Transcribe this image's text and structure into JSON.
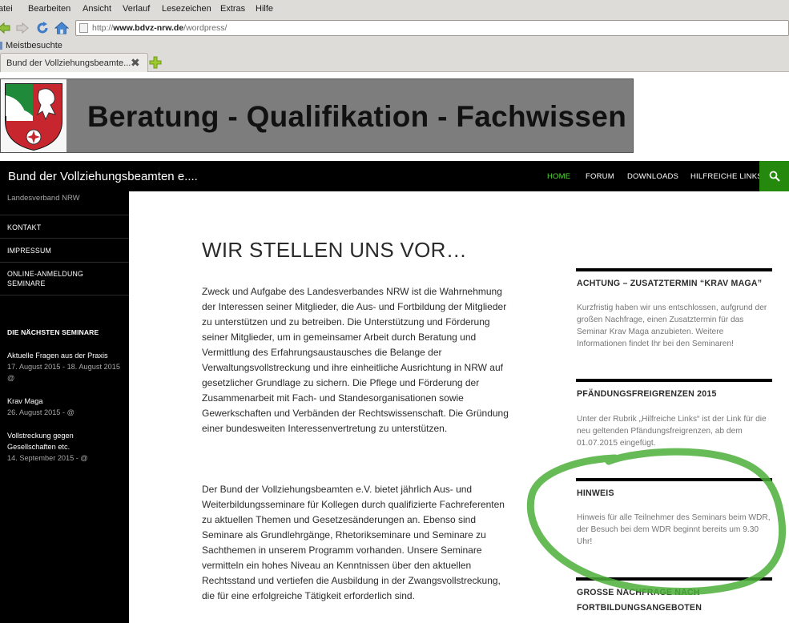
{
  "browser": {
    "menu": [
      {
        "key": "datei",
        "text": "atei",
        "underline": ""
      },
      {
        "key": "bearbeiten",
        "text": "Bearbeiten"
      },
      {
        "key": "ansicht",
        "text": "Ansicht"
      },
      {
        "key": "verlauf",
        "text": "Verlauf"
      },
      {
        "key": "lesezeichen",
        "text": "Lesezeichen"
      },
      {
        "key": "extras",
        "text": "Extras"
      },
      {
        "key": "hilfe",
        "text": "Hilfe"
      }
    ],
    "url_prefix": "http://",
    "url_host": "www.bdvz-nrw.de",
    "url_path": "/wordpress/",
    "bookmark": "Meistbesuchte",
    "tab_title": "Bund der Vollziehungsbeamte...",
    "colors": {
      "chrome": "#dedcd8",
      "new_tab_plus": "#9ccb2e"
    },
    "icons": {
      "back": "back-arrow-icon",
      "forward": "forward-arrow-icon",
      "reload": "reload-icon",
      "home": "home-icon",
      "close": "close-tab-icon",
      "new_tab": "new-tab-plus-icon"
    }
  },
  "banner": {
    "title": "Beratung - Qualifikation - Fachwissen",
    "logo": "nrw-coat-of-arms-logo"
  },
  "site": {
    "title": "Bund der Vollziehungsbeamten e....",
    "tagline": "Landesverband NRW",
    "nav": [
      "HOME",
      "FORUM",
      "DOWNLOADS",
      "HILFREICHE LINKS"
    ],
    "active_nav": "HOME",
    "accent": "#55d737",
    "search_bg": "#24890d"
  },
  "sidebar": {
    "links": [
      "KONTAKT",
      "IMPRESSUM",
      "ONLINE-ANMELDUNG SEMINARE"
    ],
    "widget_title": "DIE NÄCHSTEN SEMINARE",
    "events": [
      {
        "title": "Aktuelle Fragen aus der Praxis",
        "date": "17. August 2015 - 18. August 2015 @"
      },
      {
        "title": "Krav Maga",
        "date": "26. August 2015 - @"
      },
      {
        "title": "Vollstreckung gegen Gesellschaften etc.",
        "date": "14. September 2015 - @"
      }
    ]
  },
  "main": {
    "title": "WIR STELLEN UNS VOR…",
    "paragraphs": [
      "Zweck und Aufgabe des Landesverbandes NRW ist die Wahrnehmung der Interessen seiner Mitglieder, die Aus- und Fortbildung der Mitglieder zu unterstützen und zu betreiben. Die Unterstützung und Förderung seiner Mitglieder, um in gemeinsamer Arbeit durch Beratung und Vermittlung des Erfahrungsaustausches die Belange der Verwaltungsvollstreckung und ihre einheitliche Ausrichtung in NRW auf gesetzlicher Grundlage zu sichern. Die Pflege und Förderung der Zusammenarbeit mit Fach- und Standesorganisationen sowie Gewerkschaften und Verbänden der Rechtswissenschaft. Die Gründung einer bundesweiten Interessenvertretung zu unterstützen.",
      "Der Bund der Vollziehungsbeamten e.V. bietet jährlich Aus- und Weiterbildungsseminare für Kollegen durch qualifizierte Fachreferenten zu aktuellen Themen und Gesetzesänderungen an. Ebenso sind Seminare als Grundlehrgänge, Rhetorikseminare und Seminare zu Sachthemen in unserem Programm vorhanden. Unsere Seminare vermitteln ein hohes Niveau an Kenntnissen über den aktuellen Rechtsstand und vertiefen die Ausbildung in der Zwangsvollstreckung, die für eine erfolgreiche Tätigkeit erforderlich sind."
    ]
  },
  "widgets": [
    {
      "title": "ACHTUNG – ZUSATZTERMIN “KRAV MAGA”",
      "text": "Kurzfristig haben wir uns entschlossen, aufgrund der großen Nachfrage, einen Zusatztermin für das Seminar Krav Maga anzubieten. Weitere Informationen findet Ihr bei den Seminaren!"
    },
    {
      "title": "PFÄNDUNGSFREIGRENZEN 2015",
      "text": "Unter der Rubrik „Hilfreiche Links“ ist der Link für die neu geltenden Pfändungsfreigrenzen, ab dem 01.07.2015 eingefügt."
    },
    {
      "title": "HINWEIS",
      "text": "Hinweis für alle Teilnehmer des Seminars beim WDR, der Besuch bei dem WDR beginnt bereits um 9.30 Uhr!"
    },
    {
      "title": "GROSSE NACHFRAGE NACH FORTBILDUNGSANGEBOTEN",
      "text": ""
    }
  ],
  "annotation": {
    "color": "#4caf3a",
    "shape": "hand-drawn-circle"
  }
}
